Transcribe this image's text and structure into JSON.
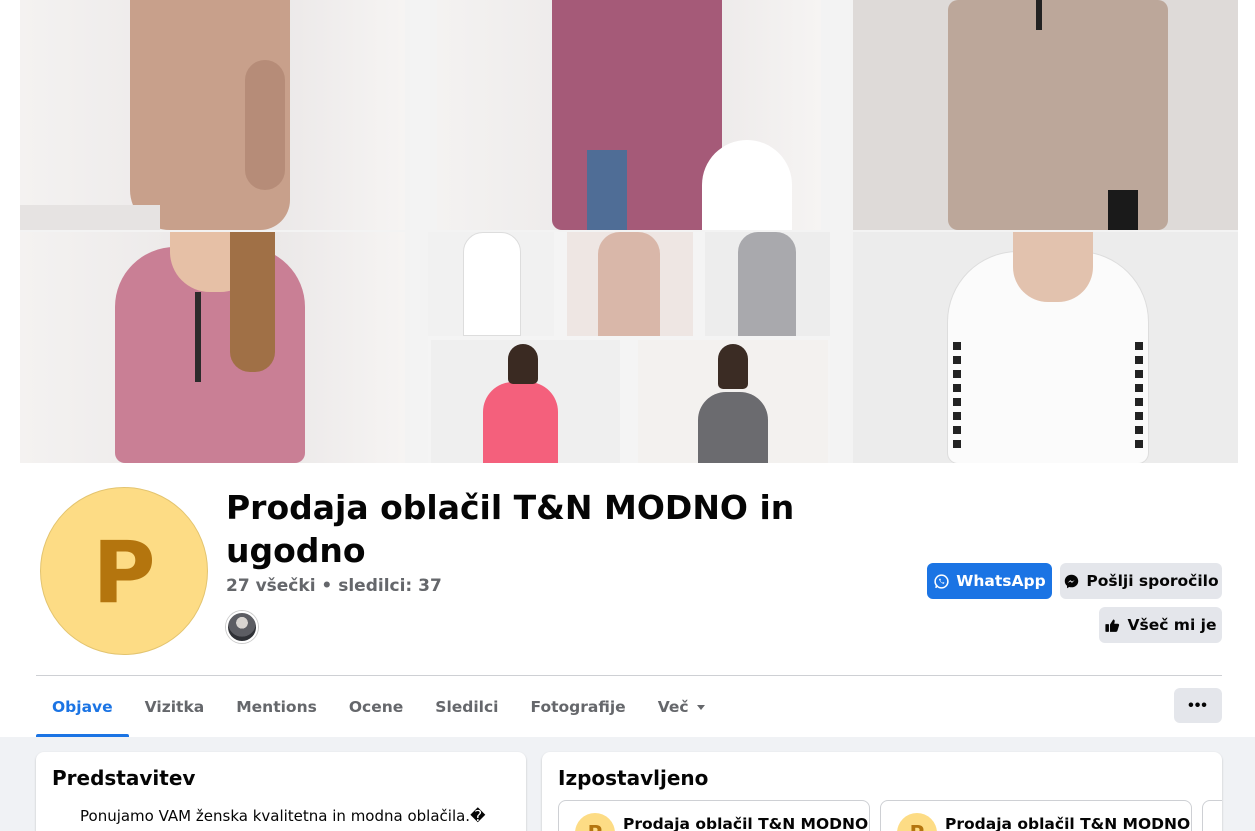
{
  "page": {
    "title": "Prodaja oblačil T&N MODNO in ugodno",
    "stats": "27 všečki • sledilci: 37",
    "avatar_letter": "P"
  },
  "actions": {
    "whatsapp_label": "WhatsApp",
    "message_label": "Pošlji sporočilo",
    "like_label": "Všeč mi je",
    "more_label": "•••"
  },
  "tabs": [
    {
      "label": "Objave",
      "active": true
    },
    {
      "label": "Vizitka"
    },
    {
      "label": "Mentions"
    },
    {
      "label": "Ocene"
    },
    {
      "label": "Sledilci"
    },
    {
      "label": "Fotografije"
    },
    {
      "label": "Več"
    }
  ],
  "intro": {
    "heading": "Predstavitev",
    "text": "Ponujamo VAM ženska kvalitetna in modna oblačila.�"
  },
  "featured": {
    "heading": "Izpostavljeno",
    "items": [
      {
        "avatar_letter": "P",
        "title": "Prodaja oblačil T&N MODNO"
      },
      {
        "avatar_letter": "P",
        "title": "Prodaja oblačil T&N MODNO"
      }
    ]
  },
  "colors": {
    "accent": "#1b74e4",
    "avatar_bg": "#fddc85",
    "avatar_letter": "#b4750e"
  },
  "icons": [
    "whatsapp-icon",
    "messenger-icon",
    "thumbs-up-icon",
    "chevron-down-icon",
    "more-icon"
  ]
}
